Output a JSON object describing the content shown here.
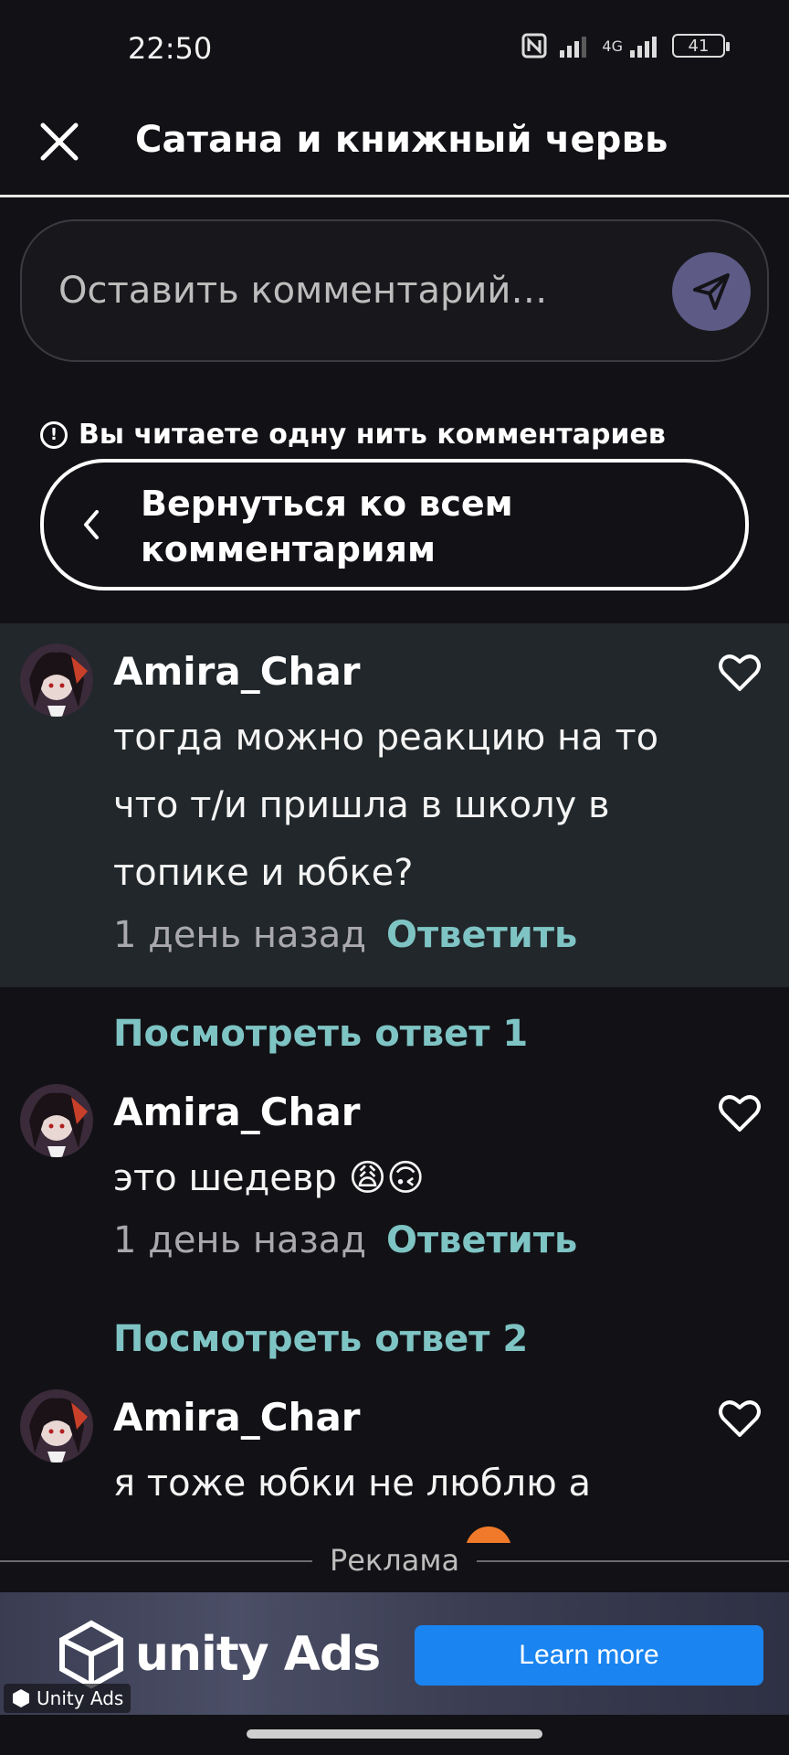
{
  "status": {
    "time": "22:50",
    "battery": "41",
    "network": "4G"
  },
  "header": {
    "title": "Сатана и книжный червь"
  },
  "comment_input": {
    "placeholder": "Оставить комментарий…"
  },
  "thread": {
    "notice": "Вы читаете одну нить комментариев",
    "back_label": "Вернуться ко всем комментариям"
  },
  "comments": [
    {
      "username": "Amira_Char",
      "text": "тогда можно реакцию на то что т/и пришла в школу в топике и юбке?",
      "timestamp": "1 день назад",
      "reply_label": "Ответить",
      "highlighted": true
    },
    {
      "username": "Amira_Char",
      "text": "это шедевр 😩🙃",
      "timestamp": "1 день назад",
      "reply_label": "Ответить"
    },
    {
      "username": "Amira_Char",
      "text": "я тоже юбки не люблю а"
    }
  ],
  "view_replies": [
    "Посмотреть ответ 1",
    "Посмотреть ответ 2"
  ],
  "ad": {
    "label": "Реклама",
    "logo_text": "unity Ads",
    "cta": "Learn more",
    "badge": "Unity Ads"
  },
  "colors": {
    "background": "#121216",
    "highlight": "#21272a",
    "accent": "#7fc4c4",
    "send_button": "#5d5a86",
    "ad_cta": "#1a84f0"
  }
}
